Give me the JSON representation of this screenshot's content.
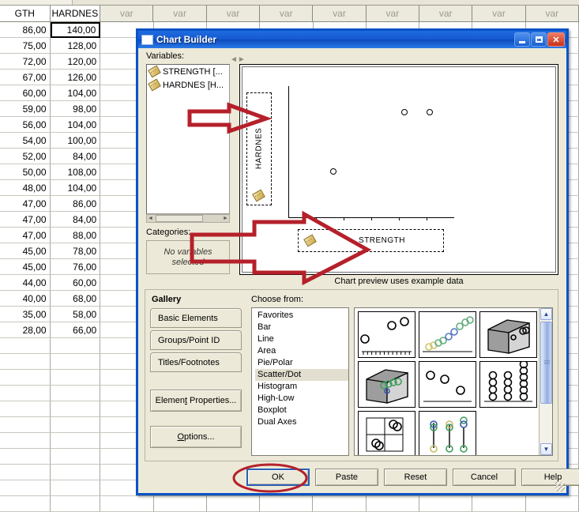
{
  "spreadsheet": {
    "columns": [
      "GTH",
      "HARDNES",
      "var",
      "var",
      "var",
      "var",
      "var",
      "var",
      "var",
      "var",
      "var"
    ],
    "rows": [
      [
        "86,00",
        "140,00"
      ],
      [
        "75,00",
        "128,00"
      ],
      [
        "72,00",
        "120,00"
      ],
      [
        "67,00",
        "126,00"
      ],
      [
        "60,00",
        "104,00"
      ],
      [
        "59,00",
        "98,00"
      ],
      [
        "56,00",
        "104,00"
      ],
      [
        "54,00",
        "100,00"
      ],
      [
        "52,00",
        "84,00"
      ],
      [
        "50,00",
        "108,00"
      ],
      [
        "48,00",
        "104,00"
      ],
      [
        "47,00",
        "86,00"
      ],
      [
        "47,00",
        "84,00"
      ],
      [
        "47,00",
        "88,00"
      ],
      [
        "45,00",
        "78,00"
      ],
      [
        "45,00",
        "76,00"
      ],
      [
        "44,00",
        "60,00"
      ],
      [
        "40,00",
        "68,00"
      ],
      [
        "35,00",
        "58,00"
      ],
      [
        "28,00",
        "66,00"
      ]
    ],
    "selected_cell": "140,00"
  },
  "dialog": {
    "title": "Chart Builder",
    "titlebar_buttons": {
      "minimize": "minimize-button",
      "maximize": "maximize-button",
      "close": "close-button"
    },
    "variables_label": "Variables:",
    "variables": [
      {
        "name": "STRENGTH [...",
        "icon": "ruler-icon"
      },
      {
        "name": "HARDNES [H...",
        "icon": "ruler-icon"
      }
    ],
    "categories_label": "Categories:",
    "categories_empty": "No variables selected",
    "preview": {
      "y_axis_label": "HARDNES",
      "x_axis_label": "STRENGTH",
      "note": "Chart preview uses example data"
    },
    "gallery": {
      "title": "Gallery",
      "tabs": [
        "Basic Elements",
        "Groups/Point ID",
        "Titles/Footnotes"
      ],
      "element_properties": "Element Properties...",
      "options": "Options..."
    },
    "choose_from": {
      "label": "Choose from:",
      "items": [
        "Favorites",
        "Bar",
        "Line",
        "Area",
        "Pie/Polar",
        "Scatter/Dot",
        "Histogram",
        "High-Low",
        "Boxplot",
        "Dual Axes"
      ],
      "selected": "Scatter/Dot"
    },
    "buttons": {
      "ok": "OK",
      "paste": "Paste",
      "reset": "Reset",
      "cancel": "Cancel",
      "help": "Help"
    }
  },
  "chart_data": {
    "type": "scatter",
    "title": "",
    "xlabel": "STRENGTH",
    "ylabel": "HARDNES",
    "note": "Chart preview uses example data",
    "points": [
      {
        "x": 0.27,
        "y": 0.35
      },
      {
        "x": 0.7,
        "y": 0.8
      },
      {
        "x": 0.85,
        "y": 0.8
      }
    ],
    "grid": false,
    "legend": "none"
  },
  "annotations": {
    "accent_color": "#b5202a",
    "arrow_top": "arrow pointing to HARDNES y-axis drop zone",
    "arrow_big": "arrow pointing to STRENGTH x-axis drop zone",
    "ellipse_ok": "red ellipse highlighting the OK button"
  }
}
